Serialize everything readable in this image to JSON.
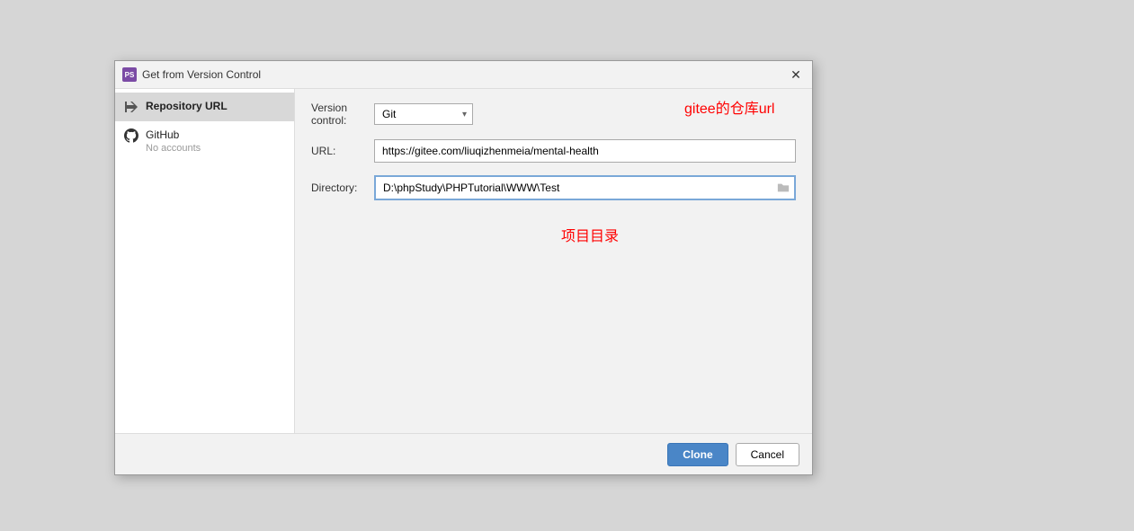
{
  "dialog": {
    "title": "Get from Version Control",
    "app_icon_text": "PS"
  },
  "sidebar": {
    "items": [
      {
        "label": "Repository URL",
        "sub": ""
      },
      {
        "label": "GitHub",
        "sub": "No accounts"
      }
    ]
  },
  "form": {
    "version_control_label": "Version control:",
    "version_control_value": "Git",
    "url_label": "URL:",
    "url_value": "https://gitee.com/liuqizhenmeia/mental-health",
    "directory_label": "Directory:",
    "directory_value": "D:\\phpStudy\\PHPTutorial\\WWW\\Test"
  },
  "annotations": {
    "url_note": "gitee的仓库url",
    "dir_note": "项目目录"
  },
  "buttons": {
    "clone": "Clone",
    "cancel": "Cancel"
  }
}
